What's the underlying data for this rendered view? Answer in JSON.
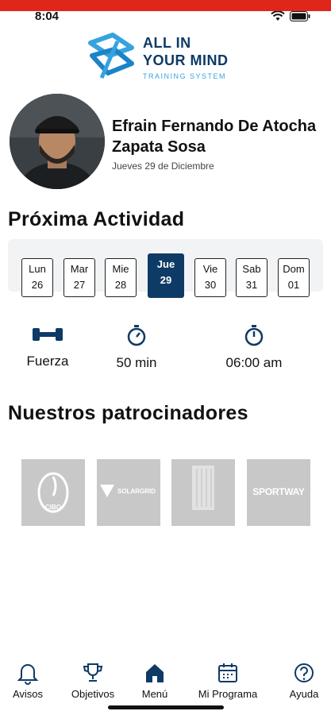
{
  "status_bar": {
    "time": "8:04"
  },
  "logo": {
    "line1": "ALL IN",
    "line2": "YOUR MIND",
    "tagline": "TRAINING SYSTEM"
  },
  "profile": {
    "name": "Efrain Fernando De Atocha Zapata Sosa",
    "date": "Jueves 29 de Diciembre"
  },
  "activity": {
    "title": "Próxima Actividad",
    "days": [
      {
        "name": "Lun",
        "num": "26"
      },
      {
        "name": "Mar",
        "num": "27"
      },
      {
        "name": "Mie",
        "num": "28"
      },
      {
        "name": "Jue",
        "num": "29"
      },
      {
        "name": "Vie",
        "num": "30"
      },
      {
        "name": "Sab",
        "num": "31"
      },
      {
        "name": "Dom",
        "num": "01"
      }
    ],
    "selected_day": "Jue",
    "type_label": "Fuerza",
    "duration": "50 min",
    "time": "06:00 am"
  },
  "sponsors": {
    "title": "Nuestros patrocinadores",
    "items": [
      {
        "name": "CIBO"
      },
      {
        "name": "SOLARGRID"
      },
      {
        "name": ""
      },
      {
        "name": "SPORTWAY"
      }
    ]
  },
  "tabbar": {
    "avisos": "Avisos",
    "objetivos": "Objetivos",
    "menu": "Menú",
    "programa": "Mi Programa",
    "ayuda": "Ayuda"
  },
  "colors": {
    "primary": "#0e3a66",
    "accent": "#36a3e0",
    "topbar": "#e0261b",
    "sponsor_bg": "#c8c8c8"
  }
}
